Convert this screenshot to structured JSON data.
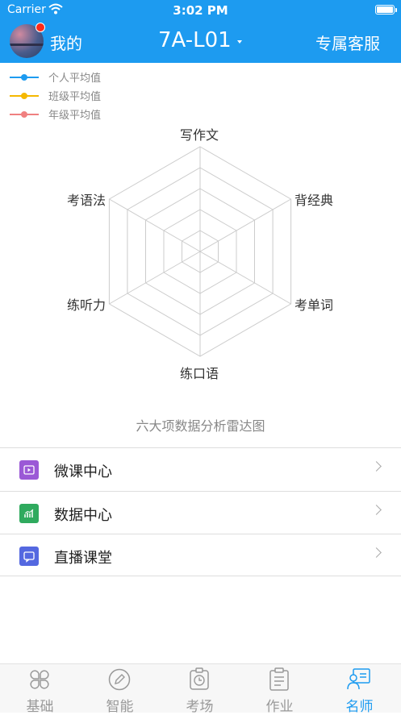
{
  "status_bar": {
    "carrier": "Carrier",
    "time": "3:02 PM"
  },
  "nav": {
    "me_label": "我的",
    "class_name": "7A-L01",
    "service_label": "专属客服"
  },
  "legend": [
    {
      "label": "个人平均值",
      "color": "#1d9bf0"
    },
    {
      "label": "班级平均值",
      "color": "#f5b800"
    },
    {
      "label": "年级平均值",
      "color": "#f08080"
    }
  ],
  "chart_data": {
    "type": "radar",
    "title": "六大项数据分析雷达图",
    "axes": [
      "写作文",
      "背经典",
      "考单词",
      "练口语",
      "练听力",
      "考语法"
    ],
    "series": [
      {
        "name": "个人平均值",
        "values": []
      },
      {
        "name": "班级平均值",
        "values": []
      },
      {
        "name": "年级平均值",
        "values": []
      }
    ],
    "rings": 5,
    "grid": true
  },
  "menu": [
    {
      "label": "微课中心",
      "icon": "play-video-icon",
      "color": "#9b59d6"
    },
    {
      "label": "数据中心",
      "icon": "bar-chart-icon",
      "color": "#2faa5e"
    },
    {
      "label": "直播课堂",
      "icon": "live-chat-icon",
      "color": "#5468e0"
    }
  ],
  "tabs": [
    {
      "label": "基础",
      "icon": "four-petal-icon",
      "active": false
    },
    {
      "label": "智能",
      "icon": "pencil-circle-icon",
      "active": false
    },
    {
      "label": "考场",
      "icon": "exam-clock-icon",
      "active": false
    },
    {
      "label": "作业",
      "icon": "clipboard-icon",
      "active": false
    },
    {
      "label": "名师",
      "icon": "teacher-icon",
      "active": true
    }
  ],
  "colors": {
    "brand_blue": "#1d9bf0",
    "tab_inactive": "#999999"
  }
}
